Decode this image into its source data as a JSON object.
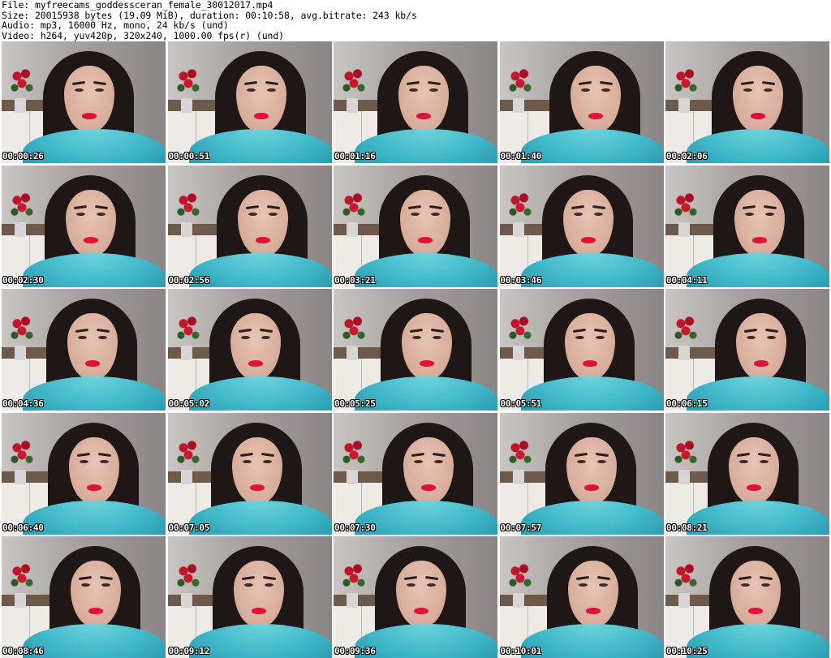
{
  "header": {
    "file_line": "File: myfreecams_goddessceran_female_30012017.mp4",
    "size_line": "Size: 20015938 bytes (19.09 MiB), duration: 00:10:58, avg.bitrate: 243 kb/s",
    "audio_line": "Audio: mp3, 16000 Hz, mono, 24 kb/s (und)",
    "video_line": "Video: h264, yuv420p, 320x240, 1000.00 fps(r) (und)"
  },
  "thumbnails": [
    {
      "timestamp": "00:00:26"
    },
    {
      "timestamp": "00:00:51"
    },
    {
      "timestamp": "00:01:16"
    },
    {
      "timestamp": "00:01:40"
    },
    {
      "timestamp": "00:02:06"
    },
    {
      "timestamp": "00:02:30"
    },
    {
      "timestamp": "00:02:56"
    },
    {
      "timestamp": "00:03:21"
    },
    {
      "timestamp": "00:03:46"
    },
    {
      "timestamp": "00:04:11"
    },
    {
      "timestamp": "00:04:36"
    },
    {
      "timestamp": "00:05:02"
    },
    {
      "timestamp": "00:05:25"
    },
    {
      "timestamp": "00:05:51"
    },
    {
      "timestamp": "00:06:15"
    },
    {
      "timestamp": "00:06:40"
    },
    {
      "timestamp": "00:07:05"
    },
    {
      "timestamp": "00:07:30"
    },
    {
      "timestamp": "00:07:57"
    },
    {
      "timestamp": "00:08:21"
    },
    {
      "timestamp": "00:08:46"
    },
    {
      "timestamp": "00:09:12"
    },
    {
      "timestamp": "00:09:36"
    },
    {
      "timestamp": "00:10:01"
    },
    {
      "timestamp": "00:10:25"
    }
  ]
}
